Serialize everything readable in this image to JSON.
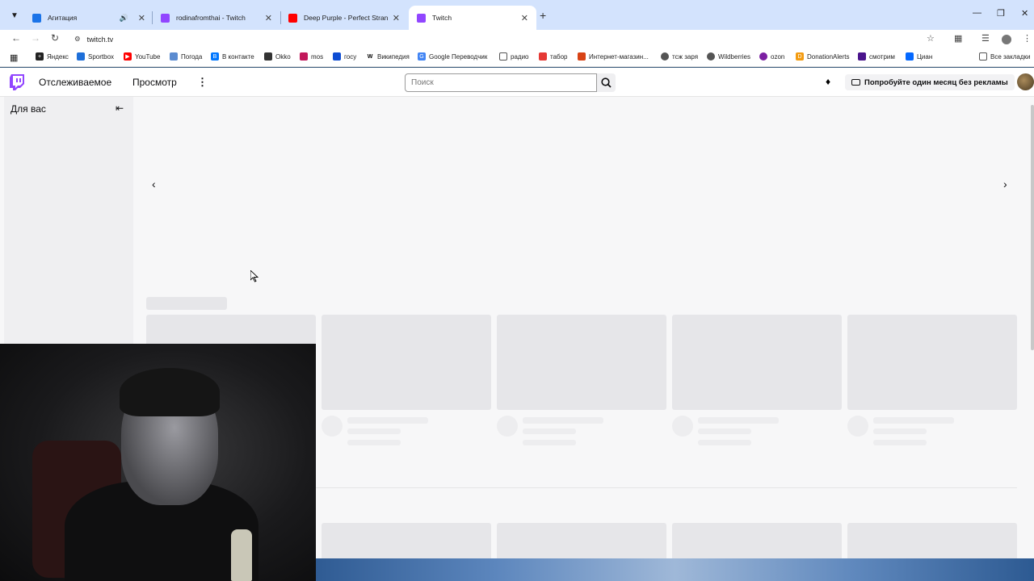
{
  "tabs": [
    {
      "title": "Агитация",
      "color": "#1a73e8"
    },
    {
      "title": "rodinafromthai - Twitch",
      "color": "#9146ff"
    },
    {
      "title": "Deep Purple - Perfect Strangers",
      "color": "#ff0000"
    },
    {
      "title": "Twitch",
      "color": "#9146ff",
      "active": true
    }
  ],
  "toolbar": {
    "url": "twitch.tv"
  },
  "bookmarks": [
    {
      "label": "Яндекс",
      "color": "#222222"
    },
    {
      "label": "Sportbox",
      "color": "#1e6fd9"
    },
    {
      "label": "YouTube",
      "color": "#ff0000"
    },
    {
      "label": "Погода",
      "color": "#5b8bd0"
    },
    {
      "label": "В контакте",
      "color": "#0077ff"
    },
    {
      "label": "Okko",
      "color": "#333333"
    },
    {
      "label": "mos",
      "color": "#c2185b"
    },
    {
      "label": "госу",
      "color": "#0d4cd3"
    },
    {
      "label": "Википедия",
      "color": "#000000"
    },
    {
      "label": "Google Переводчик",
      "color": "#4285f4"
    },
    {
      "label": "радио",
      "color": "#555555"
    },
    {
      "label": "табор",
      "color": "#e53935"
    },
    {
      "label": "Интернет-магазин...",
      "color": "#d84315"
    },
    {
      "label": "тсж заря",
      "color": "#555555"
    },
    {
      "label": "Wildberries",
      "color": "#555555"
    },
    {
      "label": "ozon",
      "color": "#7b1fa2"
    },
    {
      "label": "DonationAlerts",
      "color": "#f39c12"
    },
    {
      "label": "смотрим",
      "color": "#4a148c"
    },
    {
      "label": "Циан",
      "color": "#0468ff"
    }
  ],
  "all_bookmarks": "Все закладки",
  "twitch": {
    "nav_following": "Отслеживаемое",
    "nav_browse": "Просмотр",
    "search_placeholder": "Поиск",
    "turbo_label": "Попробуйте один месяц без рекламы",
    "sidebar_title": "Для вас",
    "accent": "#9146ff"
  }
}
